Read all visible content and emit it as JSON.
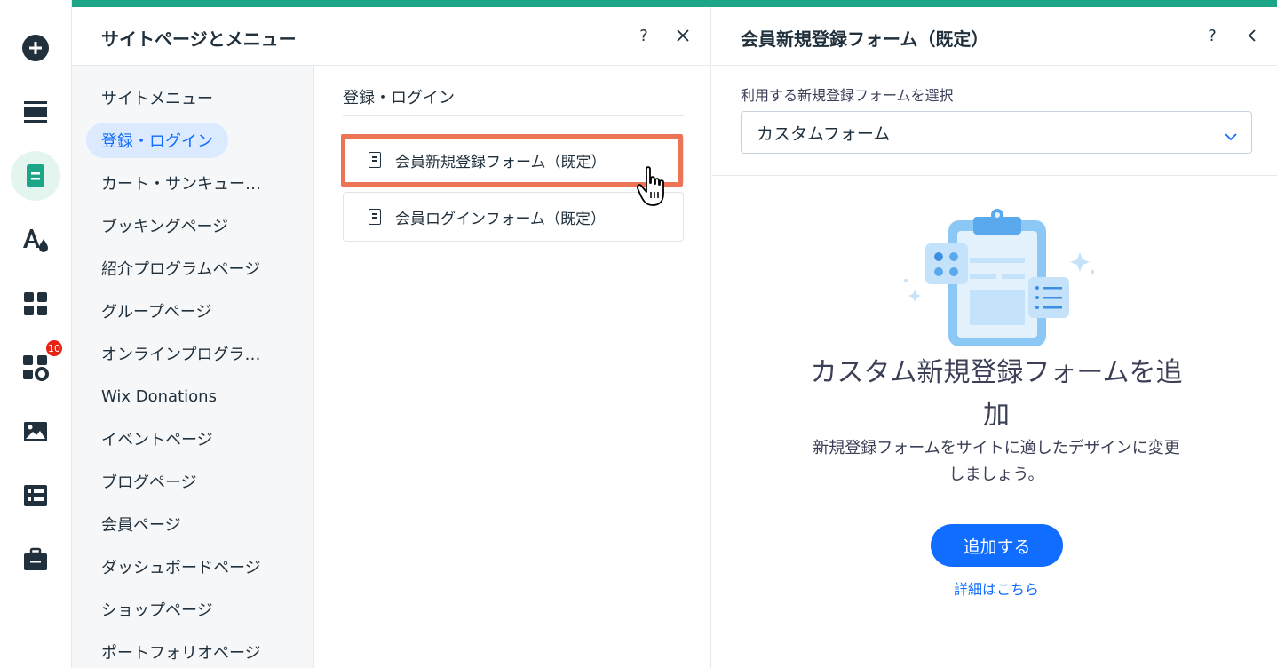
{
  "colors": {
    "accent_bar": "#1da588",
    "primary": "#116dff",
    "highlight_border": "#ee7457",
    "badge": "#e62214",
    "selected_bg": "#dbeaff"
  },
  "rail": {
    "items": [
      {
        "name": "add-icon"
      },
      {
        "name": "sections-icon"
      },
      {
        "name": "pages-icon"
      },
      {
        "name": "design-icon"
      },
      {
        "name": "apps-icon"
      },
      {
        "name": "add-apps-icon"
      },
      {
        "name": "media-icon"
      },
      {
        "name": "cms-icon"
      },
      {
        "name": "portfolio-icon"
      }
    ],
    "badge_count": "10"
  },
  "pages_panel": {
    "title": "サイトページとメニュー",
    "help_label": "?",
    "close_label": "×",
    "side_items": [
      {
        "label": "サイトメニュー"
      },
      {
        "label": "登録・ログイン"
      },
      {
        "label": "カート・サンキュー…"
      },
      {
        "label": "ブッキングページ"
      },
      {
        "label": "紹介プログラムページ"
      },
      {
        "label": "グループページ"
      },
      {
        "label": "オンラインプログラ…"
      },
      {
        "label": "Wix Donations"
      },
      {
        "label": "イベントページ"
      },
      {
        "label": "ブログページ"
      },
      {
        "label": "会員ページ"
      },
      {
        "label": "ダッシュボードページ"
      },
      {
        "label": "ショップページ"
      },
      {
        "label": "ポートフォリオページ"
      }
    ],
    "selected_index": 1,
    "section_title": "登録・ログイン",
    "pages": [
      {
        "label": "会員新規登録フォーム（既定）"
      },
      {
        "label": "会員ログインフォーム（既定）"
      }
    ]
  },
  "settings_panel": {
    "title": "会員新規登録フォーム（既定）",
    "help_label": "?",
    "back_label": "‹",
    "field_label": "利用する新規登録フォームを選択",
    "select_value": "カスタムフォーム",
    "empty_title": "カスタム新規登録フォームを追加",
    "empty_desc": "新規登録フォームをサイトに適したデザインに変更しましょう。",
    "primary_button": "追加する",
    "learn_more": "詳細はこちら"
  }
}
